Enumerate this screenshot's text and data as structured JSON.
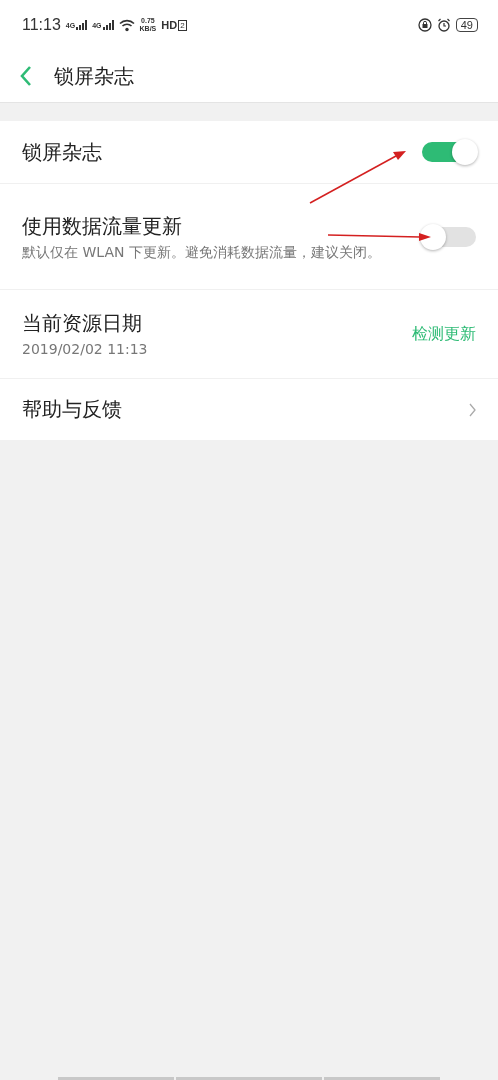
{
  "status_bar": {
    "time": "11:13",
    "signal_labels": [
      "4G",
      "4G"
    ],
    "speed_value": "0.75",
    "speed_unit": "KB/S",
    "hd_label": "HD",
    "hd_index": "2",
    "battery": "49"
  },
  "header": {
    "title": "锁屏杂志"
  },
  "settings": [
    {
      "kind": "toggle",
      "title": "锁屏杂志",
      "on": true
    },
    {
      "kind": "toggle",
      "title": "使用数据流量更新",
      "subtitle": "默认仅在 WLAN 下更新。避免消耗数据流量，建议关闭。",
      "on": false
    },
    {
      "kind": "action",
      "title": "当前资源日期",
      "subtitle": "2019/02/02 11:13",
      "action": "检测更新"
    },
    {
      "kind": "link",
      "title": "帮助与反馈"
    }
  ]
}
